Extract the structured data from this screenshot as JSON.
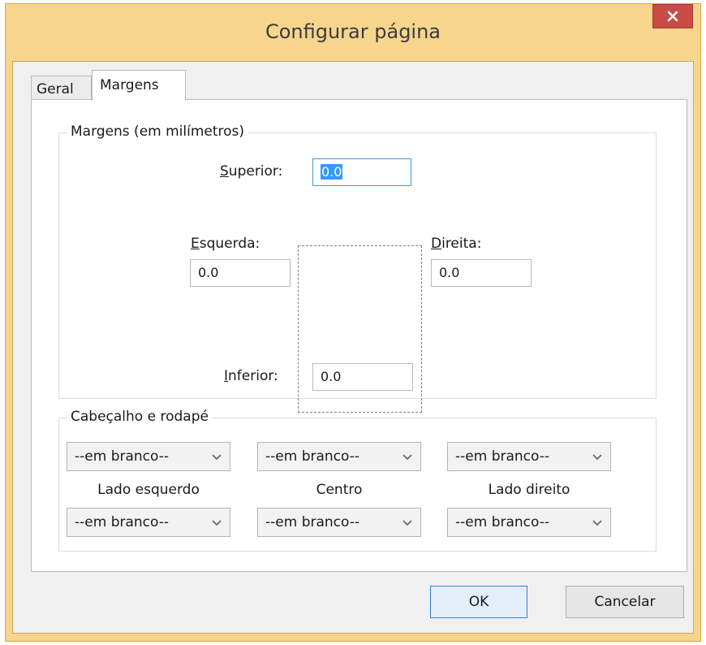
{
  "dialog": {
    "title": "Configurar página"
  },
  "tabs": [
    {
      "label": "Geral",
      "selected": false
    },
    {
      "label": "Margens",
      "selected": true
    }
  ],
  "margins": {
    "legend": "Margens (em milímetros)",
    "top": {
      "accel": "S",
      "rest": "uperior:",
      "value": "0.0"
    },
    "left": {
      "accel": "E",
      "rest": "squerda:",
      "value": "0.0"
    },
    "right": {
      "accel": "D",
      "rest": "ireita:",
      "value": "0.0"
    },
    "bottom": {
      "accel": "I",
      "rest": "nferior:",
      "value": "0.0"
    }
  },
  "header_footer": {
    "legend": "Cabeçalho e rodapé",
    "header": [
      "--em branco--",
      "--em branco--",
      "--em branco--"
    ],
    "columns": [
      "Lado esquerdo",
      "Centro",
      "Lado direito"
    ],
    "footer": [
      "--em branco--",
      "--em branco--",
      "--em branco--"
    ]
  },
  "buttons": {
    "ok": "OK",
    "cancel": "Cancelar"
  },
  "colors": {
    "title_bar": "#f7d58d",
    "close": "#c94c44",
    "focus": "#3399ff"
  },
  "icons": {
    "close": "close-icon",
    "dropdown": "chevron-down-icon"
  }
}
